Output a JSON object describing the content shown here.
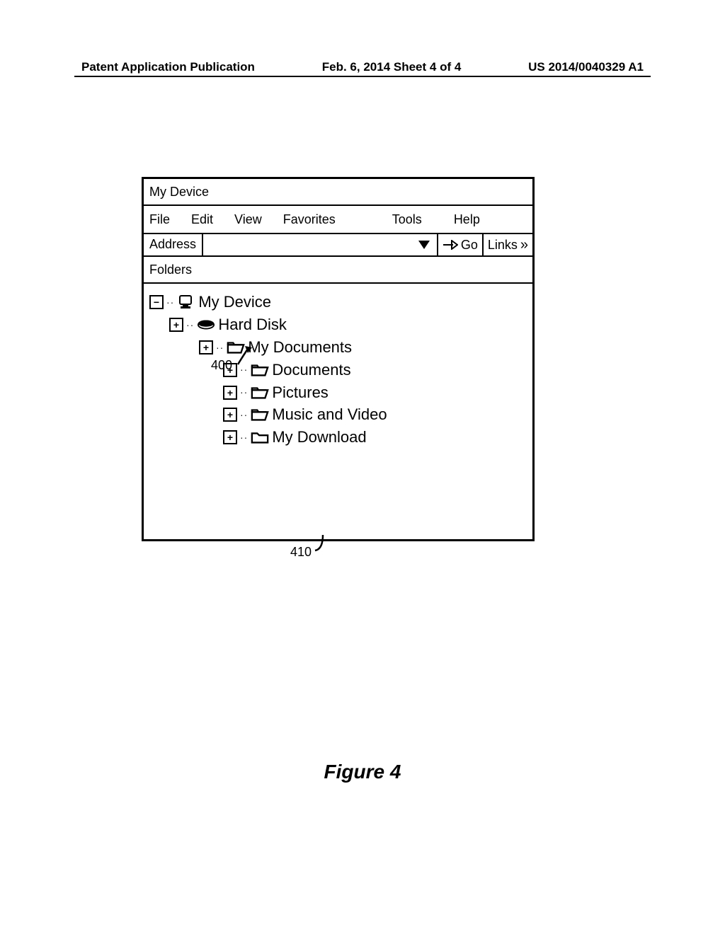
{
  "header": {
    "left": "Patent Application Publication",
    "center": "Feb. 6, 2014  Sheet 4 of 4",
    "right": "US 2014/0040329 A1"
  },
  "window": {
    "title": "My Device",
    "menu": [
      "File",
      "Edit",
      "View",
      "Favorites",
      "Tools",
      "Help"
    ],
    "address_label": "Address",
    "go_label": "Go",
    "links_label": "Links",
    "folders_label": "Folders"
  },
  "tree": {
    "root": "My Device",
    "l1": "Hard Disk",
    "l2": "My Documents",
    "children": [
      "Documents",
      "Pictures",
      "Music and Video",
      "My Download"
    ]
  },
  "callouts": {
    "ref_400": "400",
    "ref_410": "410"
  },
  "figure_caption": "Figure 4"
}
